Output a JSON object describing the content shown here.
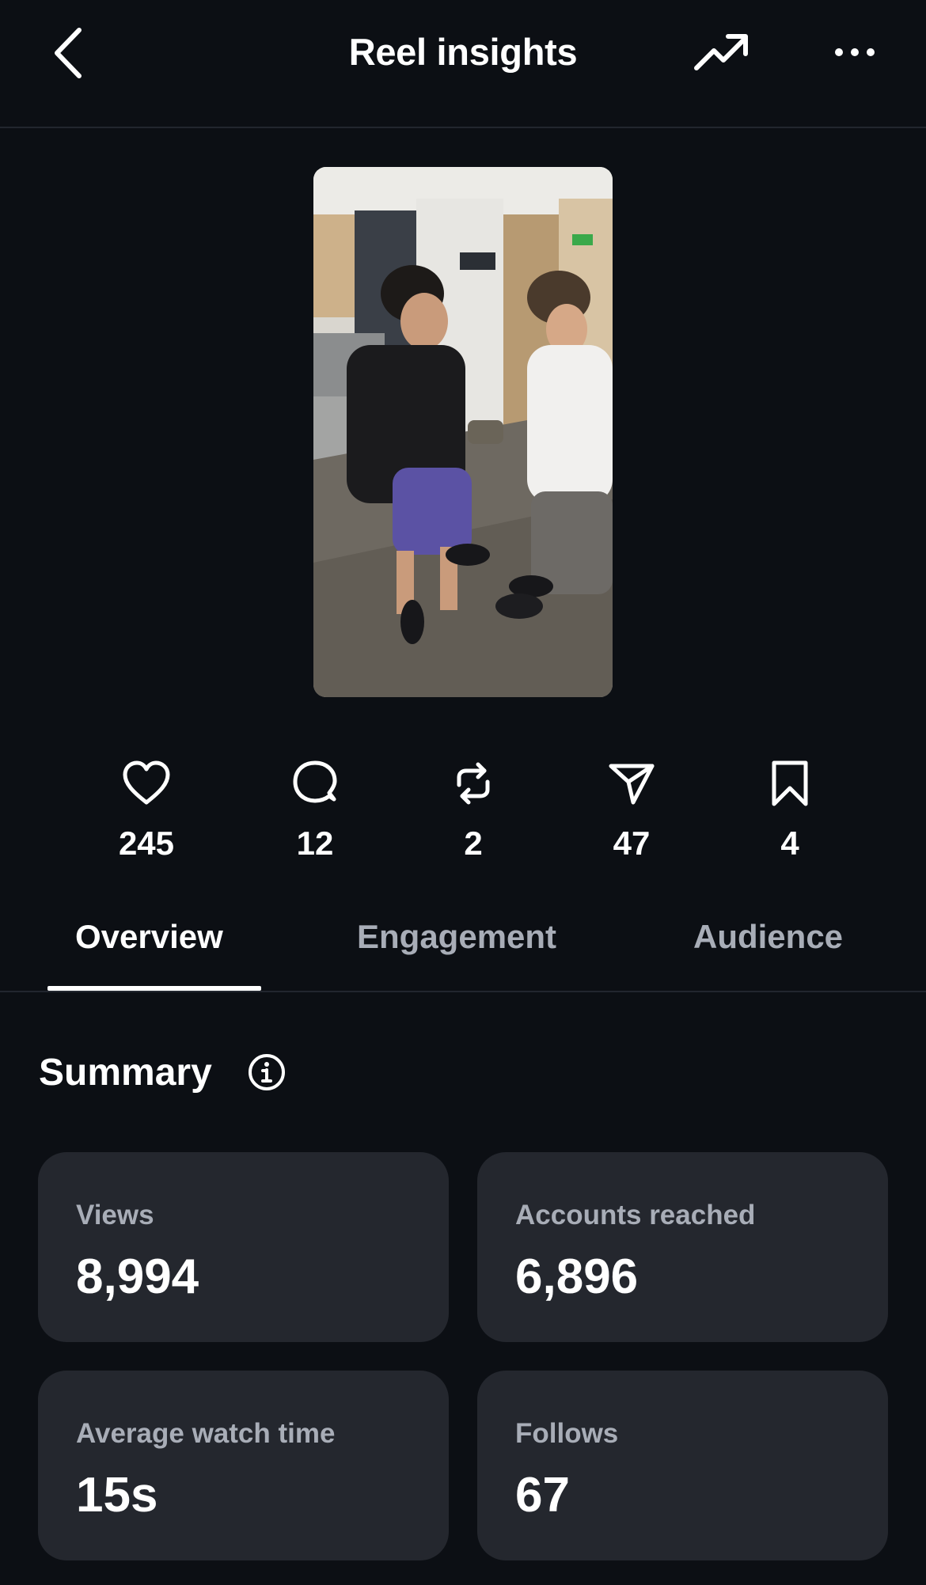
{
  "header": {
    "title": "Reel insights",
    "back_icon": "chevron-left-icon",
    "trend_icon": "trending-up-icon",
    "more_icon": "more-horizontal-icon"
  },
  "reel": {
    "thumbnail_icon": "video-thumbnail"
  },
  "stats": [
    {
      "icon": "heart-icon",
      "value": "245"
    },
    {
      "icon": "comment-icon",
      "value": "12"
    },
    {
      "icon": "repost-icon",
      "value": "2"
    },
    {
      "icon": "share-icon",
      "value": "47"
    },
    {
      "icon": "bookmark-icon",
      "value": "4"
    }
  ],
  "tabs": [
    {
      "label": "Overview",
      "active": true
    },
    {
      "label": "Engagement",
      "active": false
    },
    {
      "label": "Audience",
      "active": false
    }
  ],
  "summary": {
    "title": "Summary",
    "info_icon": "info-icon",
    "cards": [
      {
        "label": "Views",
        "value": "8,994"
      },
      {
        "label": "Accounts reached",
        "value": "6,896"
      },
      {
        "label": "Average watch time",
        "value": "15s"
      },
      {
        "label": "Follows",
        "value": "67"
      }
    ]
  },
  "colors": {
    "background": "#0c0f14",
    "card": "#24272e",
    "muted_text": "#a8adb7",
    "divider": "#22262e"
  }
}
